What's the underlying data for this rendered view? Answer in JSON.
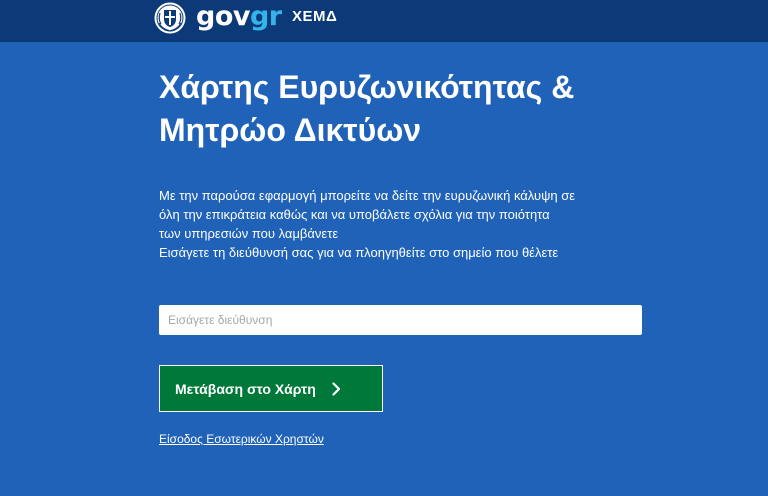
{
  "header": {
    "logo_gov": "gov",
    "logo_gr": "gr",
    "service_name": "ΧΕΜΔ",
    "emblem_icon": "greek-emblem-icon"
  },
  "main": {
    "title_line1": "Χάρτης Ευρυζωνικότητας &",
    "title_line2": "Μητρώο Δικτύων",
    "description_lines": [
      "Με την παρούσα εφαρμογή μπορείτε να δείτε την ευρυζωνική κάλυψη σε",
      "όλη την επικράτεια καθώς και να υποβάλετε σχόλια για την ποιότητα",
      "των υπηρεσιών που λαμβάνετε",
      "Εισάγετε τη διεύθυνσή σας για να πλοηγηθείτε στο σημείο που θέλετε"
    ],
    "address_input": {
      "placeholder": "Εισάγετε διεύθυνση",
      "value": ""
    },
    "go_button_label": "Μετάβαση στο Χάρτη",
    "go_button_icon": "chevron-right-icon",
    "internal_login_link": "Είσοδος Εσωτερικών Χρηστών"
  },
  "colors": {
    "background": "#1f62b8",
    "header": "#0c3a78",
    "button": "#00783a",
    "logo_accent": "#35b3ea"
  }
}
